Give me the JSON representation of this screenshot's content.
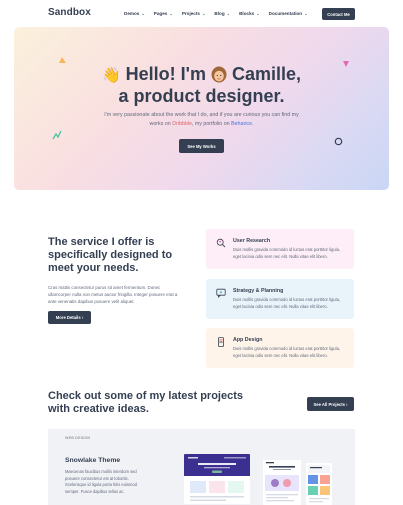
{
  "nav": {
    "logo": "Sandbox",
    "menu": [
      "Demos",
      "Pages",
      "Projects",
      "Blog",
      "Blocks",
      "Documentation"
    ],
    "contact_label": "Contact Me"
  },
  "hero": {
    "title_line1_prefix": "Hello! I'm",
    "title_line1_name": "Camille,",
    "title_line2": "a product designer.",
    "desc_before": "I'm very passionate about the work that I do, and if you are curious you can find my works on ",
    "desc_dribbble": "Dribbble",
    "desc_middle": ", my portfolio on ",
    "desc_behance": "Behance",
    "desc_after": ".",
    "button_label": "See My Works"
  },
  "services": {
    "title": "The service I offer is specifically designed to meet your needs.",
    "description": "Cras mattis consectetur purus sit amet fermentum. Donec ullamcorper nulla non metus auctor fringilla. Integer posuere erat a ante venenatis dapibus posuere velit aliquet.",
    "button_label": "More Details",
    "cards": [
      {
        "title": "User Research",
        "text": "Duis mollis gravida commodo id luctus erat porttitor ligula, eget lacinia odio sem nec elit. Nulla vitae elit libero.",
        "icon": "user-search-icon"
      },
      {
        "title": "Strategy & Planning",
        "text": "Duis mollis gravida commodo id luctus erat porttitor ligula, eget lacinia odio sem nec elit. Nulla vitae elit libero.",
        "icon": "chat-strategy-icon"
      },
      {
        "title": "App Design",
        "text": "Duis mollis gravida commodo id luctus erat porttitor ligula, eget lacinia odio sem nec elit. Nulla vitae elit libero.",
        "icon": "mobile-app-icon"
      }
    ]
  },
  "projects": {
    "title": "Check out some of my latest projects with creative ideas.",
    "button_label": "See All Projects",
    "featured": {
      "tag": "WEB DESIGN",
      "name": "Snowlake Theme",
      "description": "Maecenas faucibus mollis interdum sed posuere consectetur est at lobortis. Scelerisque id ligula porta felis euismod semper. Fusce dapibus tellus ac."
    }
  },
  "colors": {
    "dark": "#343f52",
    "dribbble": "#e2626b",
    "behance": "#3f78e0",
    "accent_purple": "#605dba"
  }
}
